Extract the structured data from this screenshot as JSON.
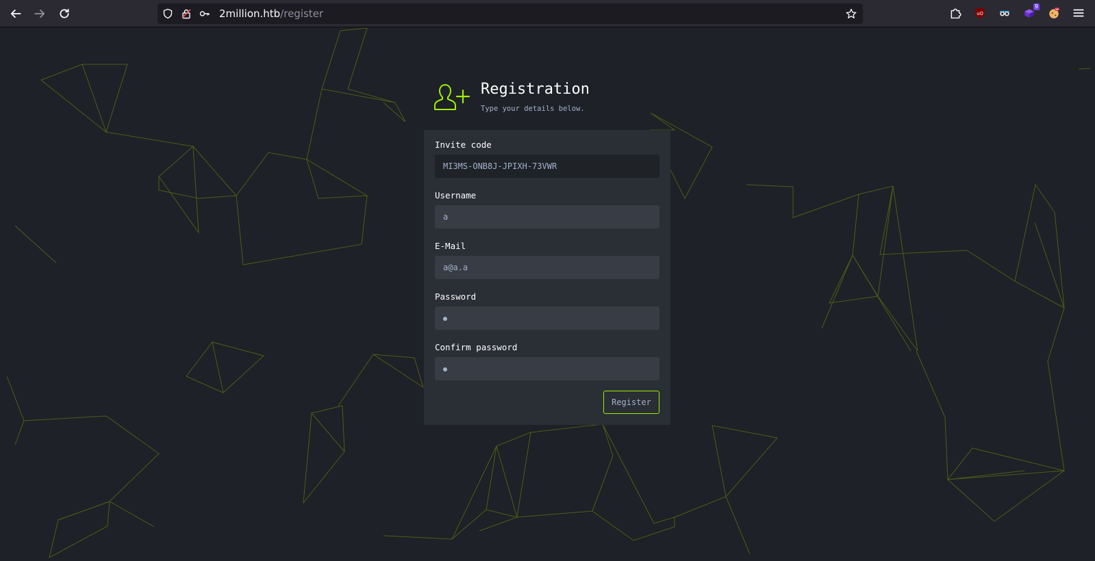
{
  "browser": {
    "url_host": "2million.htb",
    "url_path": "/register",
    "extensions": [
      {
        "name": "ublock-origin-icon",
        "label": "uO"
      },
      {
        "name": "privacy-badger-icon",
        "label": ""
      },
      {
        "name": "purple-extension-icon",
        "badge": "9"
      },
      {
        "name": "cookie-extension-icon",
        "label": ""
      }
    ]
  },
  "page": {
    "title": "Registration",
    "subtitle": "Type your details below."
  },
  "form": {
    "invite_code": {
      "label": "Invite code",
      "value": "MI3MS-ONB8J-JPIXH-73VWR"
    },
    "username": {
      "label": "Username",
      "value": "a"
    },
    "email": {
      "label": "E-Mail",
      "value": "a@a.a"
    },
    "password": {
      "label": "Password"
    },
    "confirm_password": {
      "label": "Confirm password"
    },
    "submit_label": "Register"
  },
  "colors": {
    "accent": "#9fef00",
    "background": "#1e2127",
    "card": "#2a2e35",
    "input": "#383c44"
  }
}
